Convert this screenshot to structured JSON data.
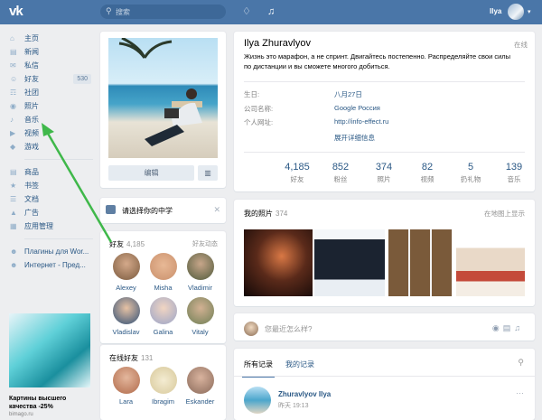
{
  "topbar": {
    "logo": "vk",
    "search_placeholder": "搜索",
    "user_name": "Ilya",
    "bell_icon": "bell-icon",
    "music_icon": "music-icon"
  },
  "sidebar": {
    "items": [
      {
        "label": "主页",
        "icon": "home-icon"
      },
      {
        "label": "新闻",
        "icon": "news-icon"
      },
      {
        "label": "私信",
        "icon": "messages-icon"
      },
      {
        "label": "好友",
        "icon": "friends-icon",
        "count": "530"
      },
      {
        "label": "社团",
        "icon": "groups-icon"
      },
      {
        "label": "照片",
        "icon": "camera-icon"
      },
      {
        "label": "音乐",
        "icon": "music-icon"
      },
      {
        "label": "视频",
        "icon": "video-icon"
      },
      {
        "label": "游戏",
        "icon": "games-icon"
      }
    ],
    "items2": [
      {
        "label": "商品",
        "icon": "goods-icon"
      },
      {
        "label": "书签",
        "icon": "star-icon"
      },
      {
        "label": "文档",
        "icon": "docs-icon"
      },
      {
        "label": "广告",
        "icon": "ads-icon"
      },
      {
        "label": "应用管理",
        "icon": "apps-icon"
      }
    ],
    "items3": [
      {
        "label": "Плагины для Wor...",
        "icon": "group-icon"
      },
      {
        "label": "Интернет - Пред...",
        "icon": "group-icon"
      }
    ]
  },
  "ad": {
    "title": "Картины высшего качества -25%",
    "domain": "bimago.ru"
  },
  "profile_photo": {
    "edit": "编辑",
    "stats_icon": "stats-icon"
  },
  "school": {
    "label": "请选择你的中学"
  },
  "friends": {
    "title": "好友",
    "count": "4,185",
    "link": "好友动态",
    "people": [
      {
        "name": "Alexey",
        "color": "#7a5a3e"
      },
      {
        "name": "Misha",
        "color": "#c98f6b"
      },
      {
        "name": "Vladimir",
        "color": "#4f5a3b"
      },
      {
        "name": "Vladislav",
        "color": "#2f4f76"
      },
      {
        "name": "Galina",
        "color": "#9aa4c8"
      },
      {
        "name": "Vitaly",
        "color": "#6f7f55"
      }
    ]
  },
  "online_friends": {
    "title": "在线好友",
    "count": "131",
    "people": [
      {
        "name": "Lara",
        "color": "#b06a4a"
      },
      {
        "name": "Ibragim",
        "color": "#d7c89a"
      },
      {
        "name": "Eskander",
        "color": "#8a6a5a"
      }
    ]
  },
  "profile": {
    "name": "Ilya Zhuravlyov",
    "online": "在线",
    "status": "Жизнь это марафон, а не спринт. Двигайтесь постепенно. Распределяйте свои силы по дистанции и вы сможете многого добиться.",
    "birthday_label": "生日:",
    "birthday": "八月27日",
    "company_label": "公司名称:",
    "company": "Google Россия",
    "website_label": "个人网址:",
    "website": "http://info-effect.ru",
    "more": "展开详细信息",
    "counters": [
      {
        "n": "4,185",
        "l": "好友"
      },
      {
        "n": "852",
        "l": "粉丝"
      },
      {
        "n": "374",
        "l": "照片"
      },
      {
        "n": "82",
        "l": "视频"
      },
      {
        "n": "5",
        "l": "扔礼物"
      },
      {
        "n": "139",
        "l": "音乐"
      }
    ]
  },
  "photos": {
    "title": "我的照片",
    "count": "374",
    "link": "在地图上显示"
  },
  "post_box": {
    "placeholder": "您最近怎么样?"
  },
  "feed": {
    "tab_all": "所有记录",
    "tab_mine": "我的记录",
    "author": "Zhuravlyov Ilya",
    "time": "昨天 19:13"
  },
  "colors": {
    "accent": "#4a76a8",
    "link": "#2a5885",
    "arrow": "#3fb84a"
  }
}
